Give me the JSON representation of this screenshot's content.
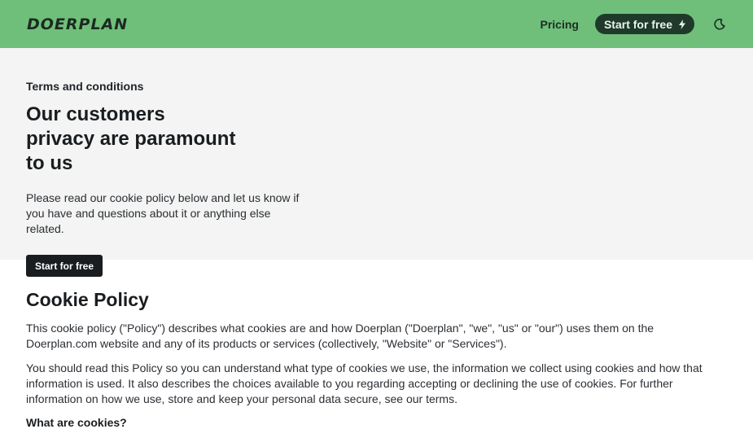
{
  "header": {
    "logo": "DOERPLAN",
    "nav_pricing": "Pricing",
    "cta_label": "Start for free",
    "icons": {
      "cta": "bolt-icon",
      "theme": "moon-icon"
    }
  },
  "hero": {
    "eyebrow": "Terms and conditions",
    "title": "Our customers privacy are paramount to us",
    "text": "Please read our cookie policy below and let us know if you have and questions about it or anything else related.",
    "button": "Start for free"
  },
  "content": {
    "title": "Cookie Policy",
    "paragraphs": [
      "This cookie policy (\"Policy\") describes what cookies are and how Doerplan (\"Doerplan\", \"we\", \"us\" or \"our\") uses them on the Doerplan.com website and any of its products or services (collectively, \"Website\" or \"Services\").",
      "You should read this Policy so you can understand what type of cookies we use, the information we collect using cookies and how that information is used. It also describes the choices available to you regarding accepting or declining the use of cookies. For further information on how we use, store and keep your personal data secure, see our terms."
    ],
    "subtitle": "What are cookies?"
  },
  "colors": {
    "header_bg": "#6fbf7a",
    "pill_bg": "#1f3a2a",
    "hero_bg": "#f3f4f3",
    "button_bg": "#1a1d20"
  }
}
